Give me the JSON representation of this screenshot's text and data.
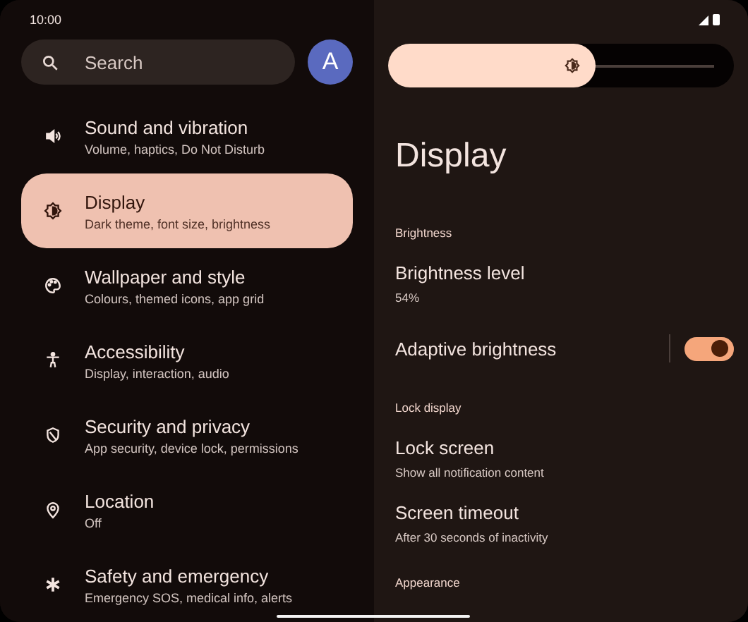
{
  "status_bar": {
    "time": "10:00"
  },
  "search": {
    "placeholder": "Search"
  },
  "account": {
    "initial": "A"
  },
  "menu": [
    {
      "title": "Sound and vibration",
      "subtitle": "Volume, haptics, Do Not Disturb",
      "selected": false
    },
    {
      "title": "Display",
      "subtitle": "Dark theme, font size, brightness",
      "selected": true
    },
    {
      "title": "Wallpaper and style",
      "subtitle": "Colours, themed icons, app grid",
      "selected": false
    },
    {
      "title": "Accessibility",
      "subtitle": "Display, interaction, audio",
      "selected": false
    },
    {
      "title": "Security and privacy",
      "subtitle": "App security, device lock, permissions",
      "selected": false
    },
    {
      "title": "Location",
      "subtitle": "Off",
      "selected": false
    },
    {
      "title": "Safety and emergency",
      "subtitle": "Emergency SOS, medical info, alerts",
      "selected": false
    }
  ],
  "brightness_slider": {
    "level": 0.6
  },
  "page_title": "Display",
  "sections": [
    {
      "heading": "Brightness",
      "items": [
        {
          "kind": "link",
          "title": "Brightness level",
          "subtitle": "54%"
        },
        {
          "kind": "toggle",
          "title": "Adaptive brightness",
          "on": true
        }
      ]
    },
    {
      "heading": "Lock display",
      "items": [
        {
          "kind": "link",
          "title": "Lock screen",
          "subtitle": "Show all notification content"
        },
        {
          "kind": "link",
          "title": "Screen timeout",
          "subtitle": "After 30 seconds of inactivity"
        }
      ]
    },
    {
      "heading": "Appearance"
    }
  ]
}
